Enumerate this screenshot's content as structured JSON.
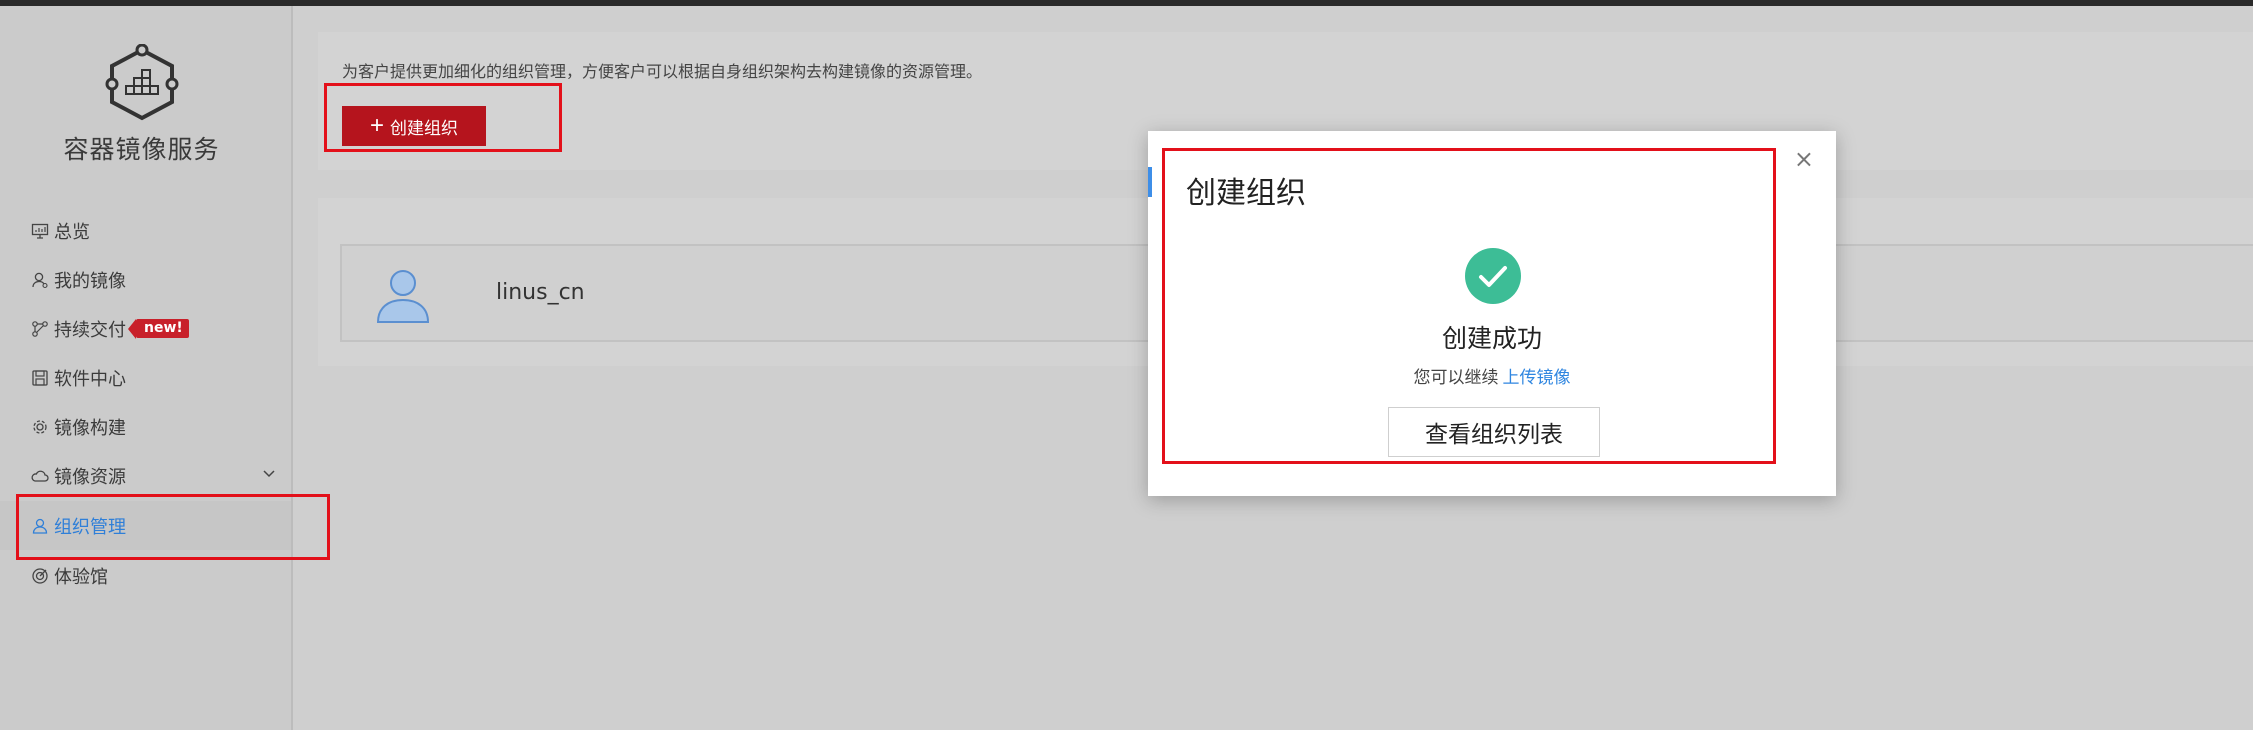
{
  "app": {
    "title": "容器镜像服务",
    "logo_icon": "container-registry-icon"
  },
  "sidebar": {
    "items": [
      {
        "label": "总览",
        "icon": "monitor-icon"
      },
      {
        "label": "我的镜像",
        "icon": "user-icon"
      },
      {
        "label": "持续交付",
        "icon": "flow-icon",
        "badge": "new!"
      },
      {
        "label": "软件中心",
        "icon": "save-icon"
      },
      {
        "label": "镜像构建",
        "icon": "gear-icon"
      },
      {
        "label": "镜像资源",
        "icon": "cloud-icon",
        "has_children": true
      },
      {
        "label": "组织管理",
        "icon": "organization-icon",
        "active": true
      },
      {
        "label": "体验馆",
        "icon": "target-icon"
      }
    ]
  },
  "main": {
    "description": "为客户提供更加细化的组织管理，方便客户可以根据自身组织架构去构建镜像的资源管理。",
    "create_button": {
      "icon": "+",
      "label": "创建组织"
    },
    "organizations": [
      {
        "name": "linus_cn",
        "icon": "user-avatar-icon"
      }
    ]
  },
  "modal": {
    "title": "创建组织",
    "close": "×",
    "success_title": "创建成功",
    "success_prefix": "您可以继续",
    "success_link": "上传镜像",
    "view_button": "查看组织列表"
  },
  "colors": {
    "accent": "#2f7fd8",
    "primary_button": "#b5141d",
    "success": "#3dbd96",
    "highlight_box": "#e3101a",
    "badge": "#c8202a"
  }
}
